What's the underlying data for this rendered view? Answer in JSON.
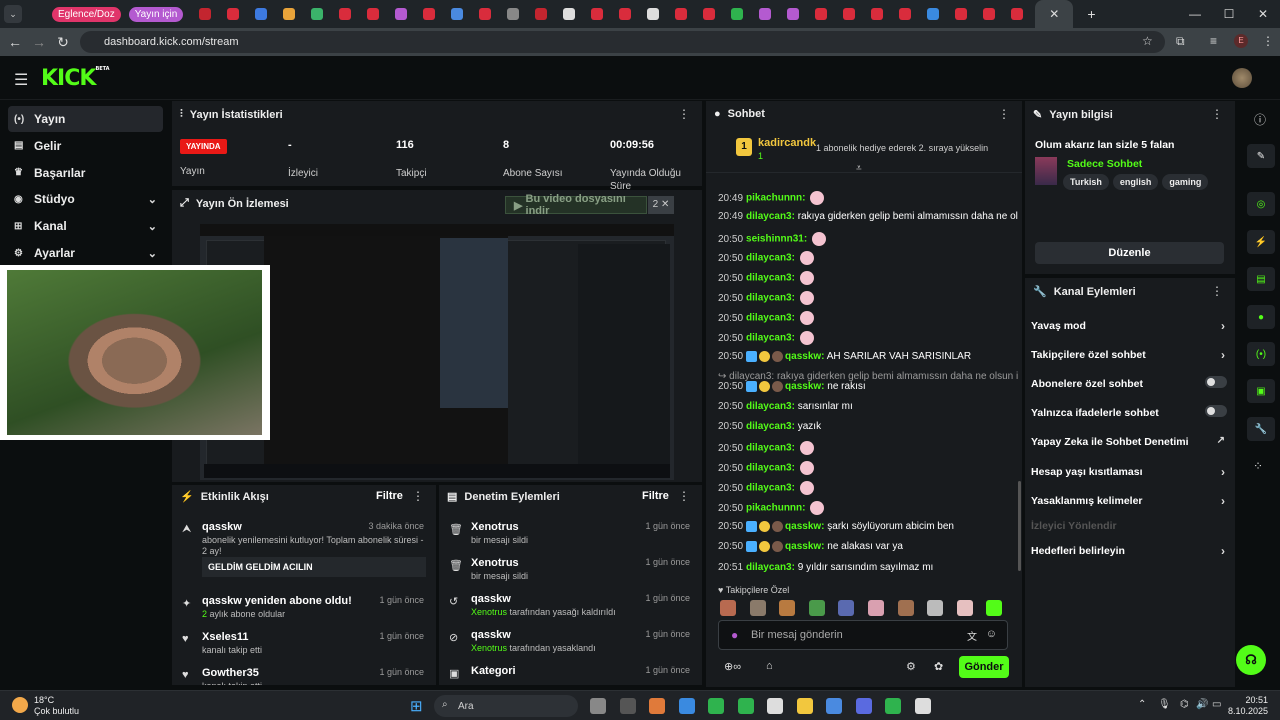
{
  "browser": {
    "tab_groups": [
      {
        "label": "Eglence/Doz",
        "color": "#e0356a"
      },
      {
        "label": "Yayın için",
        "color": "#b45ad0"
      }
    ],
    "url": "dashboard.kick.com/stream",
    "profile_initial": "E",
    "active_tab_close": "✕",
    "new_tab": "+"
  },
  "topnav": {
    "logo": "KICK",
    "logo_sup": "BETA"
  },
  "sidebar": {
    "items": [
      {
        "label": "Yayın",
        "icon": "broadcast-icon",
        "glyph": "(•)",
        "active": true
      },
      {
        "label": "Gelir",
        "icon": "chart-icon",
        "glyph": "▤"
      },
      {
        "label": "Başarılar",
        "icon": "trophy-icon",
        "glyph": "♛"
      },
      {
        "label": "Stüdyo",
        "icon": "studio-icon",
        "glyph": "◉",
        "chevron": true
      },
      {
        "label": "Kanal",
        "icon": "channel-icon",
        "glyph": "⊞",
        "chevron": true
      },
      {
        "label": "Ayarlar",
        "icon": "gear-icon",
        "glyph": "⚙",
        "chevron": true
      }
    ]
  },
  "stats": {
    "title": "Yayın İstatistikleri",
    "live_badge": "YAYINDA",
    "live_label": "Yayın",
    "viewers_value": "-",
    "viewers_label": "İzleyici",
    "followers_value": "116",
    "followers_label": "Takipçi",
    "subs_value": "8",
    "subs_label": "Abone Sayısı",
    "duration_value": "00:09:56",
    "duration_label": "Yayında Olduğu Süre"
  },
  "preview": {
    "title": "Yayın Ön İzlemesi",
    "download_banner": "Bu video dosyasını indir",
    "download_extra": "2"
  },
  "activity": {
    "title": "Etkinlik Akışı",
    "filter": "Filtre",
    "items": [
      {
        "icon": "gift-icon",
        "glyph": "⮝",
        "name": "qasskw",
        "time": "3 dakika önce",
        "sub": "abonelik yenilemesini kutluyor! Toplam abonelik süresi - 2 ay!",
        "message": "GELDİM GELDİM ACILIN"
      },
      {
        "icon": "sparkle-icon",
        "glyph": "✦",
        "name": "qasskw yeniden abone oldu!",
        "time": "1 gün önce",
        "sub_highlight": "2",
        "sub": "aylık abone oldular"
      },
      {
        "icon": "heart-icon",
        "glyph": "♥",
        "name": "Xseles11",
        "time": "1 gün önce",
        "sub": "kanalı takip etti"
      },
      {
        "icon": "heart-icon",
        "glyph": "♥",
        "name": "Gowther35",
        "time": "1 gün önce",
        "sub": "kanalı takip etti"
      }
    ]
  },
  "moderation": {
    "title": "Denetim Eylemleri",
    "filter": "Filtre",
    "items": [
      {
        "icon": "trash-icon",
        "glyph": "🗑",
        "name": "Xenotrus",
        "time": "1 gün önce",
        "sub": "bir mesajı sildi"
      },
      {
        "icon": "trash-icon",
        "glyph": "🗑",
        "name": "Xenotrus",
        "time": "1 gün önce",
        "sub": "bir mesajı sildi"
      },
      {
        "icon": "undo-icon",
        "glyph": "↺",
        "name": "qasskw",
        "time": "1 gün önce",
        "sub_highlight": "Xenotrus",
        "sub": "tarafından yasağı kaldırıldı"
      },
      {
        "icon": "ban-icon",
        "glyph": "⊘",
        "name": "qasskw",
        "time": "1 gün önce",
        "sub_highlight": "Xenotrus",
        "sub": "tarafından yasaklandı"
      },
      {
        "icon": "category-icon",
        "glyph": "▣",
        "name": "Kategori",
        "time": "1 gün önce",
        "sub": ""
      }
    ]
  },
  "chat": {
    "title": "Sohbet",
    "pinned_user": "kadircandk",
    "pinned_rank": "1",
    "pinned_count": "1",
    "pinned_text": "1 abonelik hediye ederek 2. sıraya yükselin",
    "lines": [
      {
        "time": "20:49",
        "user": "pikachunnn:",
        "text": "",
        "emote": true
      },
      {
        "time": "20:49",
        "user": "dilaycan3:",
        "text": "rakıya giderken gelip bemi almamıssın daha ne olsun"
      },
      {
        "time": "20:50",
        "user": "seishinnn31:",
        "text": "",
        "emote": true
      },
      {
        "time": "20:50",
        "user": "dilaycan3:",
        "text": "",
        "emote": true
      },
      {
        "time": "20:50",
        "user": "dilaycan3:",
        "text": "",
        "emote": true
      },
      {
        "time": "20:50",
        "user": "dilaycan3:",
        "text": "",
        "emote": true
      },
      {
        "time": "20:50",
        "user": "dilaycan3:",
        "text": "",
        "emote": true
      },
      {
        "time": "20:50",
        "user": "dilaycan3:",
        "text": "",
        "emote": true
      },
      {
        "time": "20:50",
        "user": "qasskw:",
        "text": "AH SARILAR VAH SARISINLAR",
        "badges": true
      },
      {
        "time": "",
        "user": "",
        "text": "↪ dilaycan3: rakıya giderken gelip bemi almamıssın daha ne olsun ismil ...",
        "reply": true
      },
      {
        "time": "20:50",
        "user": "qasskw:",
        "text": "ne rakısı",
        "badges": true
      },
      {
        "time": "20:50",
        "user": "dilaycan3:",
        "text": "sarısınlar mı"
      },
      {
        "time": "20:50",
        "user": "dilaycan3:",
        "text": "yazık"
      },
      {
        "time": "20:50",
        "user": "dilaycan3:",
        "text": "",
        "emote": true
      },
      {
        "time": "20:50",
        "user": "dilaycan3:",
        "text": "",
        "emote": true
      },
      {
        "time": "20:50",
        "user": "dilaycan3:",
        "text": "",
        "emote": true
      },
      {
        "time": "20:50",
        "user": "pikachunnn:",
        "text": "",
        "emote": true
      },
      {
        "time": "20:50",
        "user": "qasskw:",
        "text": "şarkı söylüyorum abicim ben",
        "badges": true
      },
      {
        "time": "20:50",
        "user": "qasskw:",
        "text": "ne alakası var ya",
        "badges": true
      },
      {
        "time": "20:51",
        "user": "dilaycan3:",
        "text": "9 yıldır sarısındım sayılmaz mı"
      }
    ],
    "followers_only_label": "Takipçilere Özel",
    "input_placeholder": "Bir mesaj gönderin",
    "send": "Gönder"
  },
  "stream_info": {
    "title": "Yayın bilgisi",
    "stream_title": "Olum akarız lan sizle 5 falan",
    "category": "Sadece Sohbet",
    "tags": [
      "Turkish",
      "english",
      "gaming"
    ],
    "edit": "Düzenle"
  },
  "channel_actions": {
    "title": "Kanal Eylemleri",
    "items": [
      {
        "label": "Yavaş mod",
        "kind": "chevron"
      },
      {
        "label": "Takipçilere özel sohbet",
        "kind": "chevron"
      },
      {
        "label": "Abonelere özel sohbet",
        "kind": "toggle"
      },
      {
        "label": "Yalnızca ifadelerle sohbet",
        "kind": "toggle"
      },
      {
        "label": "Yapay Zeka ile Sohbet Denetimi",
        "kind": "external"
      },
      {
        "label": "Hesap yaşı kısıtlaması",
        "kind": "chevron"
      },
      {
        "label": "Yasaklanmış kelimeler",
        "kind": "chevron"
      },
      {
        "label": "İzleyici Yönlendir",
        "kind": "disabled"
      },
      {
        "label": "Hedefleri belirleyin",
        "kind": "chevron"
      }
    ]
  },
  "taskbar": {
    "temp": "18°C",
    "weather": "Çok bulutlu",
    "search": "Ara",
    "time": "20:51",
    "date": "8.10.2025"
  }
}
